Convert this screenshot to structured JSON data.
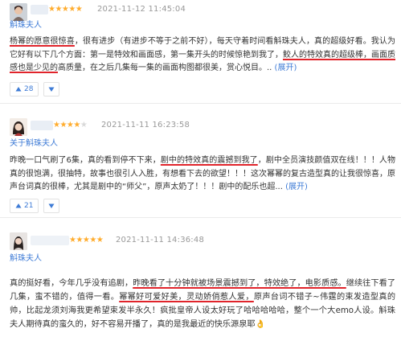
{
  "reviews": [
    {
      "rating": 5,
      "stars": "★★★★★",
      "date": "2021-11-12 11:45:04",
      "book": "斛珠夫人",
      "content": {
        "hl1": "杨幂的愿意很惊喜",
        "seg1": "，很有进步（有进步不等于之前不好），每天守着时间看斛珠夫人，真的超级好看。我认为它好有以下几个方面：第一是特效和画面感，第一集开头的时候惊艳到我了，",
        "hl2": "鲛人的特效真的超级棒，画面质感也是少见的",
        "seg2": "高质量，在之后几集每一集的画面构图都很美，赏心悦目。.. "
      },
      "more": "(展开)",
      "upvotes": "28"
    },
    {
      "rating": 4,
      "stars": "★★★★",
      "stars_off": "★",
      "date": "2021-11-11 16:23:58",
      "book": "关于斛珠夫人",
      "content": {
        "seg1": "昨晚一口气刷了6集，真的看到停不下来，",
        "hl1": "剧中的特效真的震撼到我了",
        "seg2": "，剧中全员演技颜值双在线！！！人物真的很饱满，很抽特，故事也很引人入胜，有想看下去的欲望！！！这次幂幂的复古造型真的让我很惊喜，原声台词真的很棒，尤其是剧中的“师父”，原声太奶了！！！剧中的配乐也超... "
      },
      "more": "(展开)",
      "upvotes": "21"
    },
    {
      "rating": 5,
      "stars": "★★★★★",
      "date": "2021-11-11 14:36:48",
      "book": "斛珠夫人",
      "content": {
        "seg1": "真的挺好看，今年几乎没有追剧，",
        "hl1": "昨晚看了十分钟就被场景震撼到了，特效绝了，电影质感。",
        "seg2": "继续往下看了几集，蛮不错的，值得一看。",
        "hl2": "幂幂好可爱好美，灵动娇俏惹人爱，",
        "seg3": "原声台词不错子~伟霆的束发造型真的帅，比起龙须刘海我更希望束发半永久！疯批皇帝人设太好玩了哈哈哈哈哈，整个一个大emo人设。斛珠夫人期待真的蛮久的，好不容易开播了，真的是我最近的快乐源泉耶👌"
      }
    }
  ]
}
